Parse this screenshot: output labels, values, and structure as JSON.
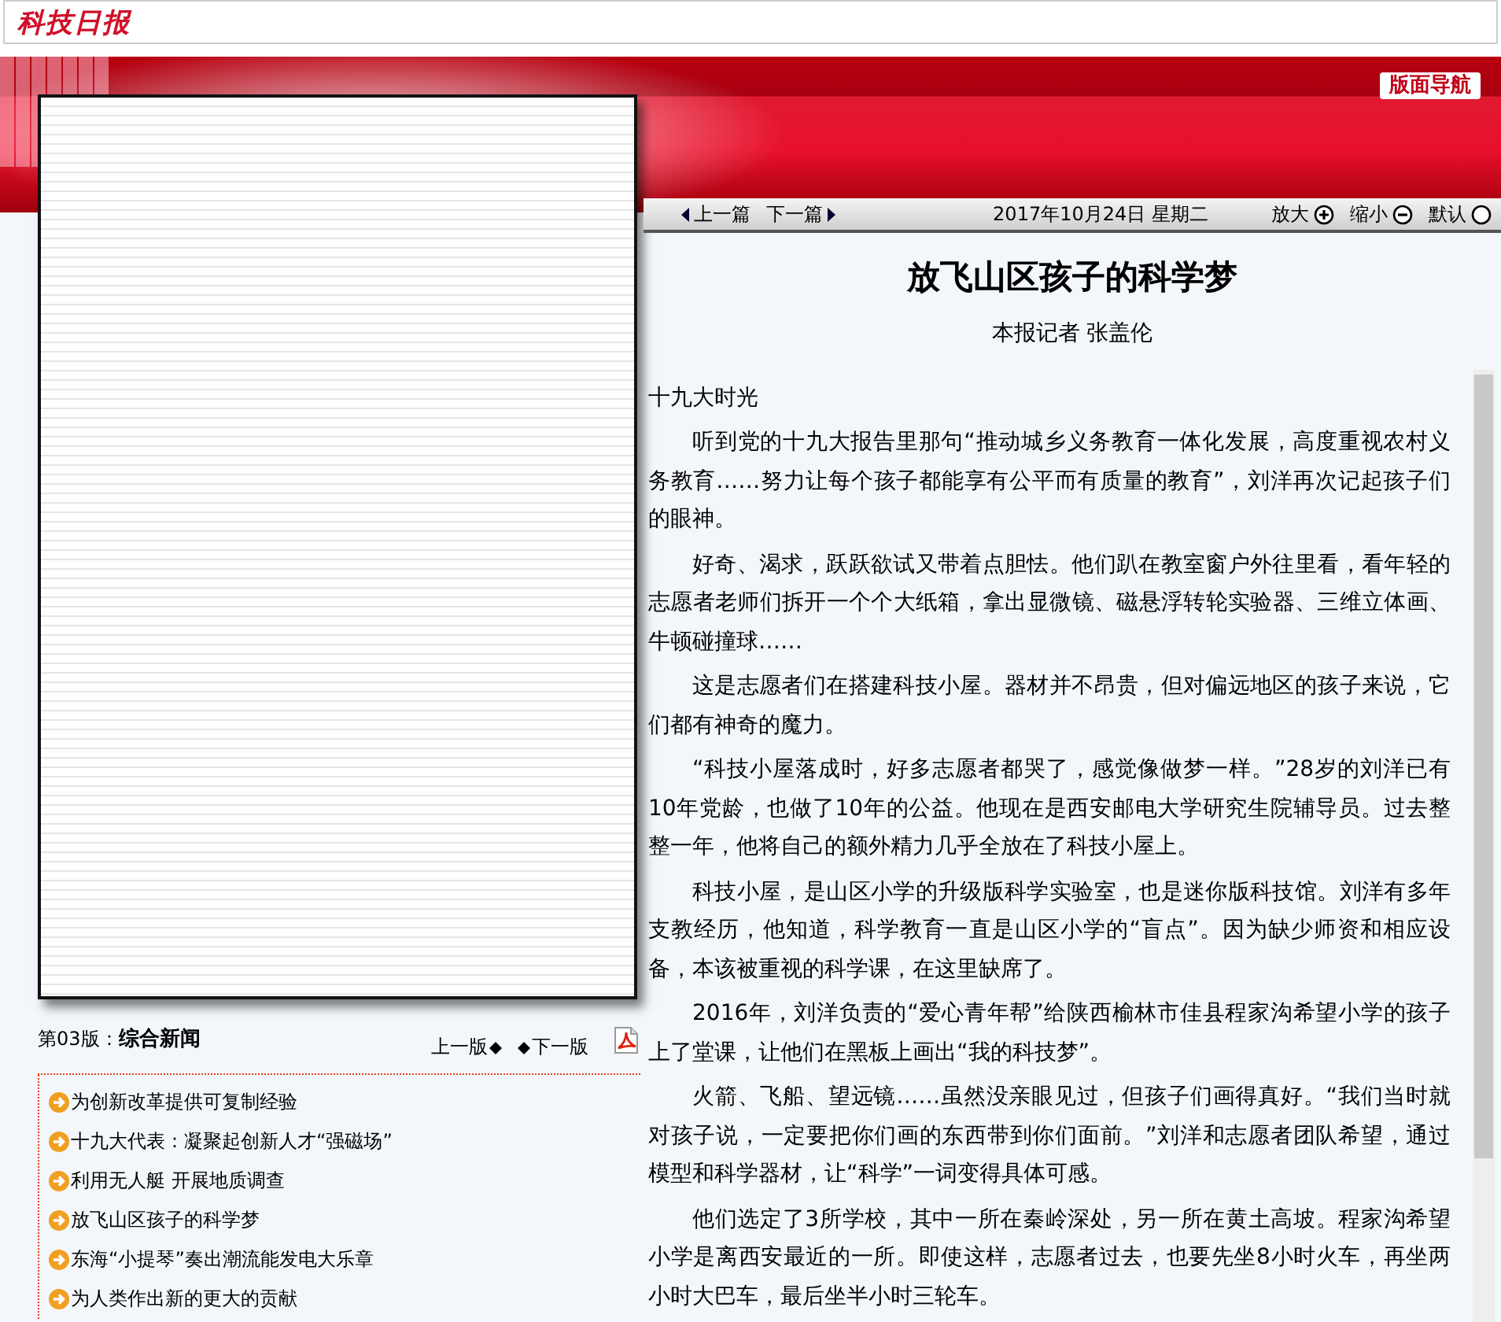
{
  "header": {
    "logo": "科技日报"
  },
  "banner": {
    "nav_button": "版面导航"
  },
  "page_view": {
    "edition": "第03版：**综合新闻**",
    "prev_edition": "上一版",
    "next_edition": "下一版"
  },
  "headlines": [
    {
      "title": "为创新改革提供可复制经验"
    },
    {
      "title": "十九大代表：凝聚起创新人才“强磁场”"
    },
    {
      "title": "利用无人艇 开展地质调查"
    },
    {
      "title": "放飞山区孩子的科学梦"
    },
    {
      "title": "东海“小提琴”奏出潮流能发电大乐章"
    },
    {
      "title": "为人类作出新的更大的贡献"
    }
  ],
  "toolbar": {
    "prev": "上一篇",
    "next": "下一篇",
    "date": "2017年10月24日  星期二",
    "zoom_in": "放大",
    "zoom_out": "缩小",
    "reset": "默认"
  },
  "article": {
    "title": "放飞山区孩子的科学梦",
    "byline": "本报记者  张盖伦",
    "section": "十九大时光",
    "paragraphs": [
      "听到党的十九大报告里那句“推动城乡义务教育一体化发展，高度重视农村义务教育……努力让每个孩子都能享有公平而有质量的教育”，刘洋再次记起孩子们的眼神。",
      "好奇、渴求，跃跃欲试又带着点胆怯。他们趴在教室窗户外往里看，看年轻的志愿者老师们拆开一个个大纸箱，拿出显微镜、磁悬浮转轮实验器、三维立体画、牛顿碰撞球……",
      "这是志愿者们在搭建科技小屋。器材并不昂贵，但对偏远地区的孩子来说，它们都有神奇的魔力。",
      "“科技小屋落成时，好多志愿者都哭了，感觉像做梦一样。”28岁的刘洋已有10年党龄，也做了10年的公益。他现在是西安邮电大学研究生院辅导员。过去整整一年，他将自己的额外精力几乎全放在了科技小屋上。",
      "科技小屋，是山区小学的升级版科学实验室，也是迷你版科技馆。刘洋有多年支教经历，他知道，科学教育一直是山区小学的“盲点”。因为缺少师资和相应设备，本该被重视的科学课，在这里缺席了。",
      "2016年，刘洋负责的“爱心青年帮”给陕西榆林市佳县程家沟希望小学的孩子上了堂课，让他们在黑板上画出“我的科技梦”。",
      "火箭、飞船、望远镜……虽然没亲眼见过，但孩子们画得真好。“我们当时就对孩子说，一定要把你们画的东西带到你们面前。”刘洋和志愿者团队希望，通过模型和科学器材，让“科学”一词变得具体可感。",
      "他们选定了3所学校，其中一所在秦岭深处，另一所在黄土高坡。程家沟希望小学是离西安最近的一所。即使这样，志愿者过去，也要先坐8小时火车，再坐两小时大巴车，最后坐半小时三轮车。"
    ]
  }
}
